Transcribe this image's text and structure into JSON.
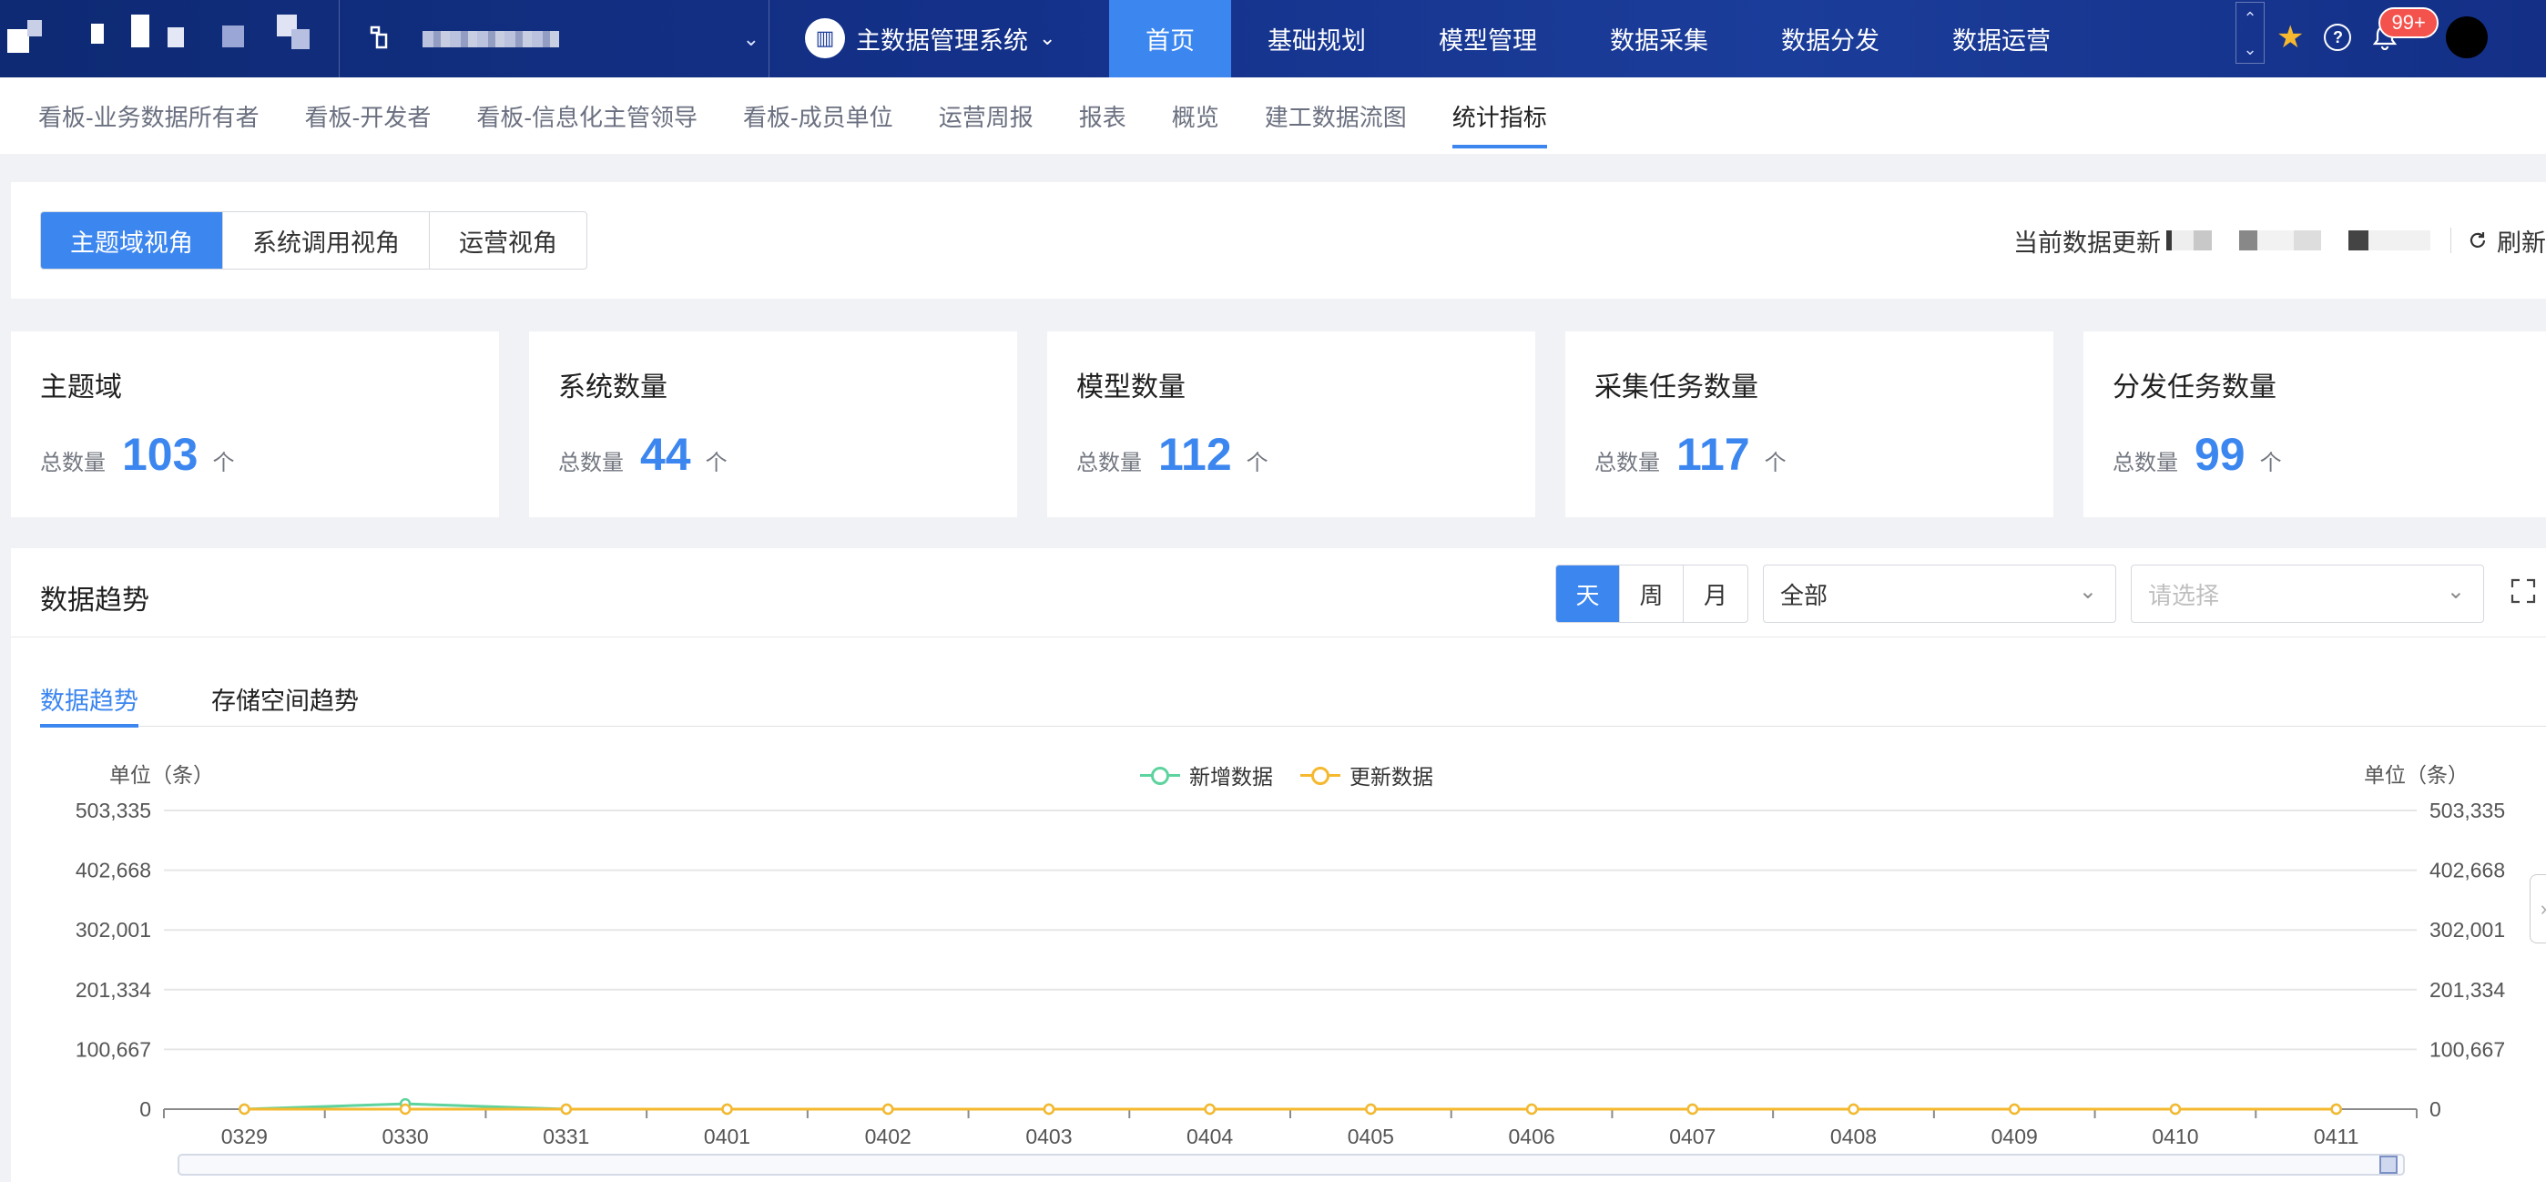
{
  "topnav": {
    "system_name": "主数据管理系统",
    "menu": [
      "首页",
      "基础规划",
      "模型管理",
      "数据采集",
      "数据分发",
      "数据运营"
    ],
    "active_menu": 0,
    "notification_count": "99+"
  },
  "subtabs": {
    "items": [
      "看板-业务数据所有者",
      "看板-开发者",
      "看板-信息化主管领导",
      "看板-成员单位",
      "运营周报",
      "报表",
      "概览",
      "建工数据流图",
      "统计指标"
    ],
    "active": 8
  },
  "views": {
    "items": [
      "主题域视角",
      "系统调用视角",
      "运营视角"
    ],
    "active": 0,
    "update_label": "当前数据更新",
    "refresh_label": "刷新"
  },
  "stats": [
    {
      "title": "主题域",
      "label": "总数量",
      "value": "103",
      "unit": "个"
    },
    {
      "title": "系统数量",
      "label": "总数量",
      "value": "44",
      "unit": "个"
    },
    {
      "title": "模型数量",
      "label": "总数量",
      "value": "112",
      "unit": "个"
    },
    {
      "title": "采集任务数量",
      "label": "总数量",
      "value": "117",
      "unit": "个"
    },
    {
      "title": "分发任务数量",
      "label": "总数量",
      "value": "99",
      "unit": "个"
    }
  ],
  "trend": {
    "title": "数据趋势",
    "periods": [
      "天",
      "周",
      "月"
    ],
    "active_period": 0,
    "select1_value": "全部",
    "select2_placeholder": "请选择",
    "tabs": [
      "数据趋势",
      "存储空间趋势"
    ],
    "active_tab": 0,
    "unit_left": "单位（条）",
    "unit_right": "单位（条）"
  },
  "chart_data": {
    "type": "line",
    "categories": [
      "0329",
      "0330",
      "0331",
      "0401",
      "0402",
      "0403",
      "0404",
      "0405",
      "0406",
      "0407",
      "0408",
      "0409",
      "0410",
      "0411"
    ],
    "series": [
      {
        "name": "新增数据",
        "color": "#5dd39e",
        "values": [
          0,
          9000,
          0,
          0,
          0,
          0,
          0,
          0,
          0,
          0,
          0,
          0,
          0,
          0
        ]
      },
      {
        "name": "更新数据",
        "color": "#f5b82e",
        "values": [
          0,
          0,
          0,
          0,
          0,
          0,
          0,
          0,
          0,
          0,
          0,
          0,
          0,
          0
        ]
      }
    ],
    "yticks": [
      "0",
      "100,667",
      "201,334",
      "302,001",
      "402,668",
      "503,335"
    ],
    "ylim": [
      0,
      503335
    ],
    "ylabel_left": "单位（条）",
    "ylabel_right": "单位（条）",
    "legend": "top-center",
    "grid": true
  }
}
